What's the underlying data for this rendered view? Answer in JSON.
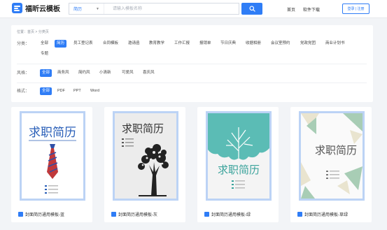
{
  "header": {
    "logo_text": "福昕云模板",
    "search_category": "简历",
    "search_placeholder": "请输入模板名称",
    "nav": [
      "首页",
      "软件下载"
    ],
    "login_label": "登录 | 注册"
  },
  "breadcrumb": "位置：首页 > 分类页",
  "filters": {
    "category": {
      "label": "分类：",
      "options": [
        "全部",
        "简历",
        "员工登记表",
        "合同模板",
        "邀请函",
        "教育教学",
        "工作汇报",
        "报销单",
        "节日庆典",
        "收据相册",
        "会议室预约",
        "党政党团",
        "商业计划书",
        "专题"
      ],
      "active": "简历"
    },
    "style": {
      "label": "风格：",
      "options": [
        "全部",
        "商务风",
        "简约风",
        "小清新",
        "可爱风",
        "喜庆风"
      ],
      "active": "全部"
    },
    "format": {
      "label": "格式：",
      "options": [
        "全部",
        "PDF",
        "PPT",
        "Word"
      ],
      "active": "全部"
    }
  },
  "templates": [
    {
      "title": "封面简历通用模板-蓝",
      "cover_text": "求职简历"
    },
    {
      "title": "封面简历通用模板-灰",
      "cover_text": "求职简历"
    },
    {
      "title": "封面简历通用模板-绿",
      "cover_text": "求职简历"
    },
    {
      "title": "封面简历通用模板-草绿",
      "cover_text": "求职简历"
    }
  ],
  "colors": {
    "accent": "#2f7df6",
    "thumb_border": "#bcd3f5",
    "teal": "#5bbcb5",
    "sage": "#a8cdb5"
  }
}
